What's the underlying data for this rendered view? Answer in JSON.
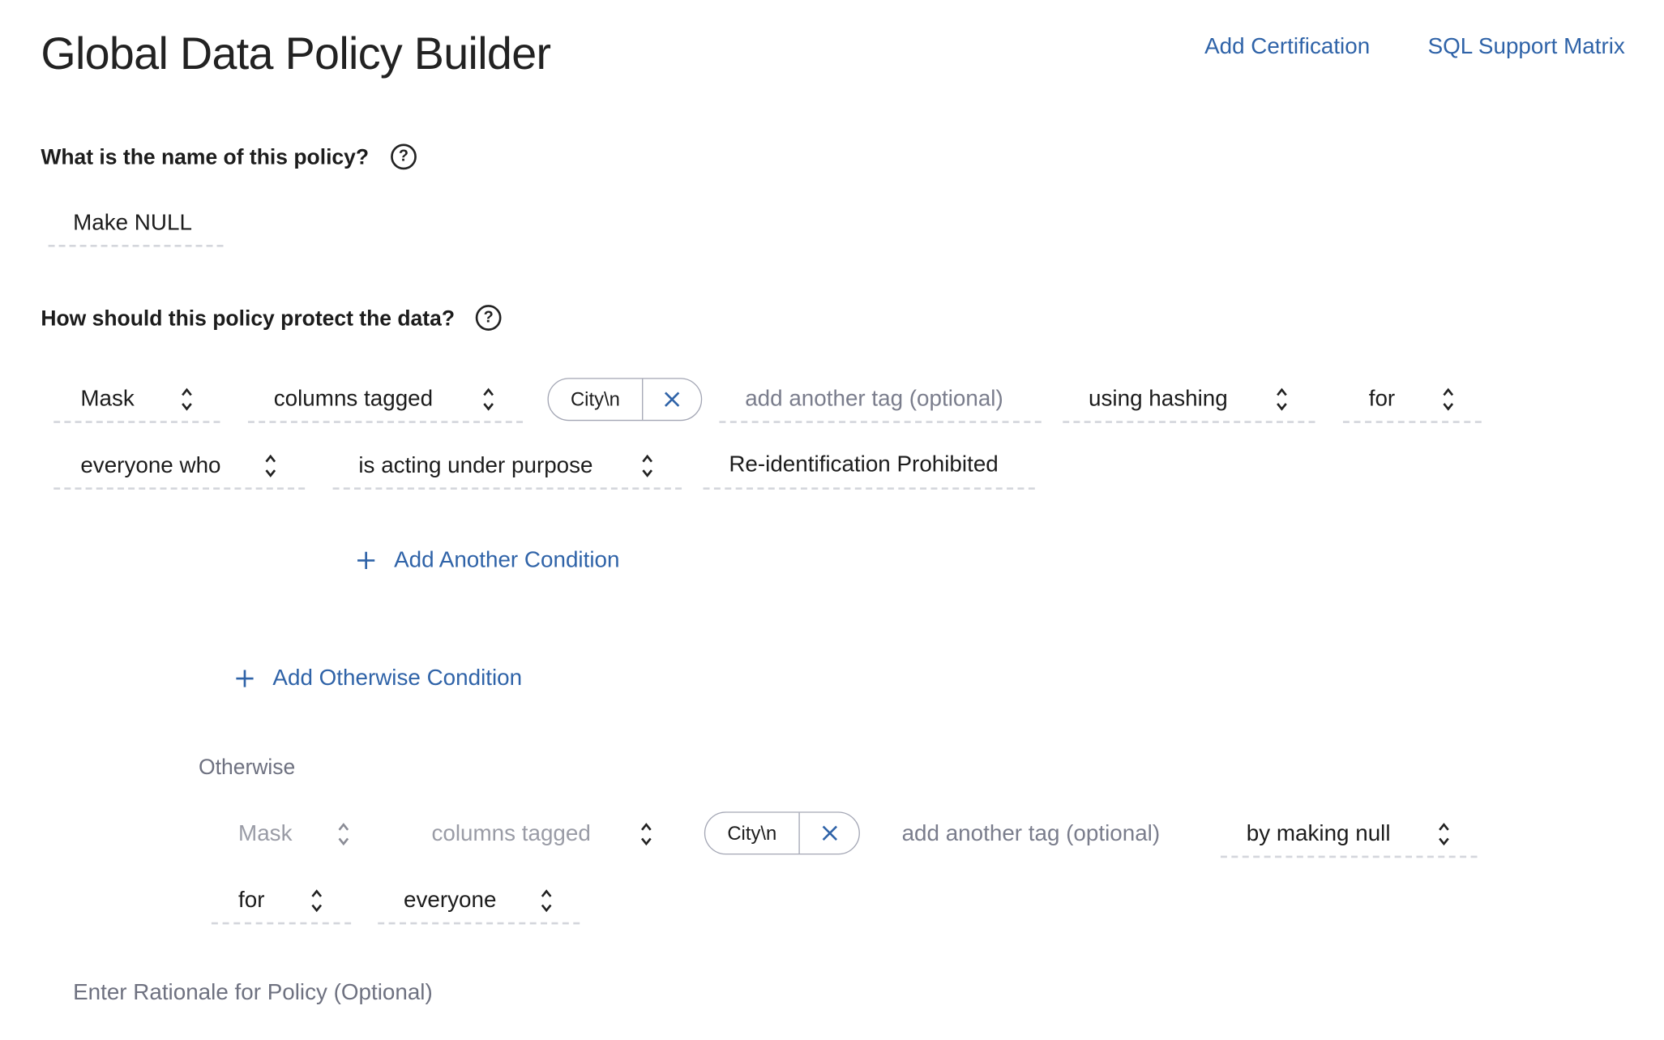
{
  "header": {
    "title": "Global Data Policy Builder",
    "links": [
      "Add Certification",
      "SQL Support Matrix"
    ]
  },
  "name_section": {
    "question": "What is the name of this policy?",
    "help_icon": "question-circle-icon",
    "policy_name": "Make NULL"
  },
  "protect_section": {
    "question": "How should this policy protect the data?",
    "help_icon": "question-circle-icon",
    "rule": {
      "action": "Mask",
      "target": "columns tagged",
      "tags": [
        "City\\n"
      ],
      "tag_placeholder": "add another tag (optional)",
      "method": "using hashing",
      "for": "for",
      "subject": "everyone who",
      "condition": "is acting under purpose",
      "purpose": "Re-identification Prohibited"
    },
    "add_condition": "Add Another Condition",
    "add_otherwise": "Add Otherwise Condition",
    "otherwise": {
      "label": "Otherwise",
      "action": "Mask",
      "target": "columns tagged",
      "tags": [
        "City\\n"
      ],
      "tag_placeholder": "add another tag (optional)",
      "method": "by making null",
      "for": "for",
      "subject": "everyone"
    }
  },
  "rationale": {
    "placeholder": "Enter Rationale for Policy (Optional)"
  },
  "colors": {
    "link": "#2f63a8",
    "text": "#1c1c1c",
    "muted": "#9a9ca6",
    "divider": "#d4d6dc"
  }
}
